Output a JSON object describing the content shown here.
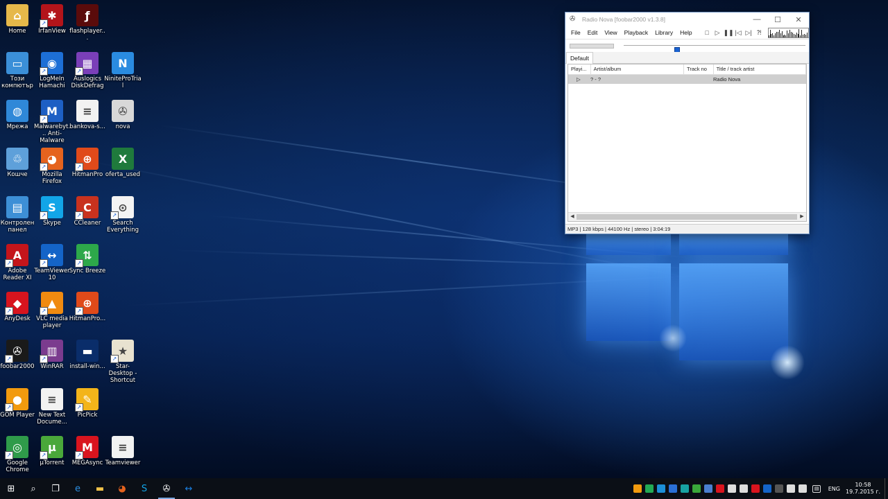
{
  "desktop": {
    "icons": [
      {
        "label": "Home",
        "icon": "folder-user-icon",
        "bg": "#e6b84a",
        "glyph": "⌂",
        "shortcut": false
      },
      {
        "label": "IrfanView",
        "icon": "irfanview-icon",
        "bg": "#b3141a",
        "glyph": "✱",
        "shortcut": true
      },
      {
        "label": "flashplayer...",
        "icon": "flash-player-icon",
        "bg": "#5a0b0b",
        "glyph": "ƒ",
        "shortcut": false
      },
      {
        "label": "Този компютър",
        "icon": "computer-icon",
        "bg": "#3b8fd8",
        "glyph": "▭",
        "shortcut": false
      },
      {
        "label": "LogMeIn Hamachi",
        "icon": "hamachi-icon",
        "bg": "#1d6fd6",
        "glyph": "◉",
        "shortcut": true
      },
      {
        "label": "Auslogics DiskDefrag",
        "icon": "disk-defrag-icon",
        "bg": "#7a3fb8",
        "glyph": "▦",
        "shortcut": true
      },
      {
        "label": "NiniteProTrial",
        "icon": "ninite-icon",
        "bg": "#2a8be0",
        "glyph": "N",
        "shortcut": false
      },
      {
        "label": "Мрежа",
        "icon": "network-icon",
        "bg": "#2f88d8",
        "glyph": "◍",
        "shortcut": false
      },
      {
        "label": "Malwarebyt... Anti-Malware",
        "icon": "malwarebytes-icon",
        "bg": "#1d5fc4",
        "glyph": "M",
        "shortcut": true
      },
      {
        "label": "bankova-s...",
        "icon": "text-file-icon",
        "bg": "#f2f2f2",
        "glyph": "≡",
        "shortcut": false
      },
      {
        "label": "nova",
        "icon": "foobar-file-icon",
        "bg": "#d8d8d8",
        "glyph": "✇",
        "shortcut": false
      },
      {
        "label": "Кошче",
        "icon": "recycle-bin-icon",
        "bg": "#5ea0da",
        "glyph": "♲",
        "shortcut": false
      },
      {
        "label": "Mozilla Firefox",
        "icon": "firefox-icon",
        "bg": "#e5631e",
        "glyph": "◕",
        "shortcut": true
      },
      {
        "label": "HitmanPro",
        "icon": "hitmanpro-icon",
        "bg": "#e04a1a",
        "glyph": "⊕",
        "shortcut": true
      },
      {
        "label": "oferta_used",
        "icon": "excel-file-icon",
        "bg": "#1f7a3c",
        "glyph": "X",
        "shortcut": false
      },
      {
        "label": "Контролен панел",
        "icon": "control-panel-icon",
        "bg": "#3d8fd6",
        "glyph": "▤",
        "shortcut": false
      },
      {
        "label": "Skype",
        "icon": "skype-icon",
        "bg": "#12a5e8",
        "glyph": "S",
        "shortcut": true
      },
      {
        "label": "CCleaner",
        "icon": "ccleaner-icon",
        "bg": "#c8321e",
        "glyph": "C",
        "shortcut": true
      },
      {
        "label": "Search Everything",
        "icon": "search-everything-icon",
        "bg": "#f3f3f3",
        "glyph": "⊙",
        "shortcut": true
      },
      {
        "label": "Adobe Reader XI",
        "icon": "adobe-reader-icon",
        "bg": "#c4151b",
        "glyph": "A",
        "shortcut": true
      },
      {
        "label": "TeamViewer 10",
        "icon": "teamviewer-icon",
        "bg": "#1464c8",
        "glyph": "↔",
        "shortcut": true
      },
      {
        "label": "Sync Breeze",
        "icon": "sync-breeze-icon",
        "bg": "#2da84a",
        "glyph": "⇅",
        "shortcut": true
      },
      {
        "label": "AnyDesk",
        "icon": "anydesk-icon",
        "bg": "#d7141e",
        "glyph": "◆",
        "shortcut": true
      },
      {
        "label": "VLC media player",
        "icon": "vlc-icon",
        "bg": "#f08a10",
        "glyph": "▲",
        "shortcut": true
      },
      {
        "label": "HitmanPro...",
        "icon": "hitmanpro-icon",
        "bg": "#e04a1a",
        "glyph": "⊕",
        "shortcut": true
      },
      {
        "label": "foobar2000",
        "icon": "foobar2000-icon",
        "bg": "#1a1a1a",
        "glyph": "✇",
        "shortcut": true
      },
      {
        "label": "WinRAR",
        "icon": "winrar-icon",
        "bg": "#7b3b8e",
        "glyph": "▥",
        "shortcut": true
      },
      {
        "label": "install-win...",
        "icon": "install-windows-icon",
        "bg": "#0a2d6a",
        "glyph": "▬",
        "shortcut": false
      },
      {
        "label": "Star-Desktop - Shortcut",
        "icon": "star-desktop-icon",
        "bg": "#e8e2d0",
        "glyph": "★",
        "shortcut": true
      },
      {
        "label": "GOM Player",
        "icon": "gom-player-icon",
        "bg": "#f29a0e",
        "glyph": "●",
        "shortcut": true
      },
      {
        "label": "New Text Docume...",
        "icon": "text-file-icon",
        "bg": "#f2f2f2",
        "glyph": "≡",
        "shortcut": false
      },
      {
        "label": "PicPick",
        "icon": "picpick-icon",
        "bg": "#f3b41a",
        "glyph": "✎",
        "shortcut": true
      },
      {
        "label": "Google Chrome",
        "icon": "chrome-icon",
        "bg": "#2f9b4a",
        "glyph": "◎",
        "shortcut": true
      },
      {
        "label": "µTorrent",
        "icon": "utorrent-icon",
        "bg": "#4aa83a",
        "glyph": "µ",
        "shortcut": true
      },
      {
        "label": "MEGAsync",
        "icon": "megasync-icon",
        "bg": "#d9141e",
        "glyph": "M",
        "shortcut": true
      },
      {
        "label": "Teamviewer",
        "icon": "text-file-icon",
        "bg": "#f2f2f2",
        "glyph": "≡",
        "shortcut": false
      }
    ]
  },
  "foobar": {
    "title": "Radio Nova   [foobar2000 v1.3.8]",
    "app_icon": "foobar2000-icon",
    "window_buttons": [
      {
        "icon": "minimize-icon",
        "glyph": "—"
      },
      {
        "icon": "maximize-icon",
        "glyph": "☐"
      },
      {
        "icon": "close-icon",
        "glyph": "✕"
      }
    ],
    "menu": [
      "File",
      "Edit",
      "View",
      "Playback",
      "Library",
      "Help"
    ],
    "toolbar": [
      {
        "icon": "stop-icon",
        "glyph": "□"
      },
      {
        "icon": "play-icon",
        "glyph": "▷"
      },
      {
        "icon": "pause-icon",
        "glyph": "❚❚"
      },
      {
        "icon": "previous-icon",
        "glyph": "|◁"
      },
      {
        "icon": "next-icon",
        "glyph": "▷|"
      },
      {
        "icon": "random-icon",
        "glyph": "⁈"
      }
    ],
    "seek_position": 0.28,
    "tab": "Default",
    "columns": [
      "Playi...",
      "Artist/album",
      "Track no",
      "Title / track artist"
    ],
    "rows": [
      {
        "playing_icon": "play-indicator-icon",
        "playing": "▷",
        "artist_album": "? - ?",
        "track_no": "",
        "title": "Radio Nova"
      }
    ],
    "status": "MP3 | 128 kbps | 44100 Hz | stereo | 3:04:19"
  },
  "taskbar": {
    "buttons": [
      {
        "icon": "windows-start-icon",
        "glyph": "⊞",
        "active": false
      },
      {
        "icon": "search-icon",
        "glyph": "⌕",
        "active": false
      },
      {
        "icon": "task-view-icon",
        "glyph": "❐",
        "active": false
      },
      {
        "icon": "edge-icon",
        "glyph": "e",
        "active": false
      },
      {
        "icon": "file-explorer-icon",
        "glyph": "▬",
        "active": false
      },
      {
        "icon": "firefox-icon",
        "glyph": "◕",
        "active": false
      },
      {
        "icon": "skype-icon",
        "glyph": "S",
        "active": false
      },
      {
        "icon": "foobar2000-icon",
        "glyph": "✇",
        "active": true
      },
      {
        "icon": "teamviewer-icon",
        "glyph": "↔",
        "active": false
      }
    ],
    "tray_icons": [
      {
        "icon": "gom-tray-icon",
        "color": "#f29a0e"
      },
      {
        "icon": "tray-b-icon",
        "color": "#22aa55"
      },
      {
        "icon": "tray-s-icon",
        "color": "#1c8fd8"
      },
      {
        "icon": "tray-blue-icon",
        "color": "#2a6fd6"
      },
      {
        "icon": "tray-teal-icon",
        "color": "#17a2a2"
      },
      {
        "icon": "tray-green-icon",
        "color": "#3aa83a"
      },
      {
        "icon": "tray-shield-icon",
        "color": "#4a7fd0"
      },
      {
        "icon": "tray-red-icon",
        "color": "#d9141e"
      },
      {
        "icon": "onedrive-icon",
        "color": "#dddddd"
      },
      {
        "icon": "network-tray-icon",
        "color": "#dddddd"
      },
      {
        "icon": "mega-tray-icon",
        "color": "#d9141e"
      },
      {
        "icon": "teamviewer-tray-icon",
        "color": "#1464c8"
      },
      {
        "icon": "show-hidden-icon",
        "color": "#555555"
      },
      {
        "icon": "tray-network-status-icon",
        "color": "#dddddd"
      },
      {
        "icon": "volume-icon",
        "color": "#dddddd"
      }
    ],
    "language": "ENG",
    "time": "10:58",
    "date": "19.7.2015 г.",
    "notification_icon": "action-center-icon"
  }
}
